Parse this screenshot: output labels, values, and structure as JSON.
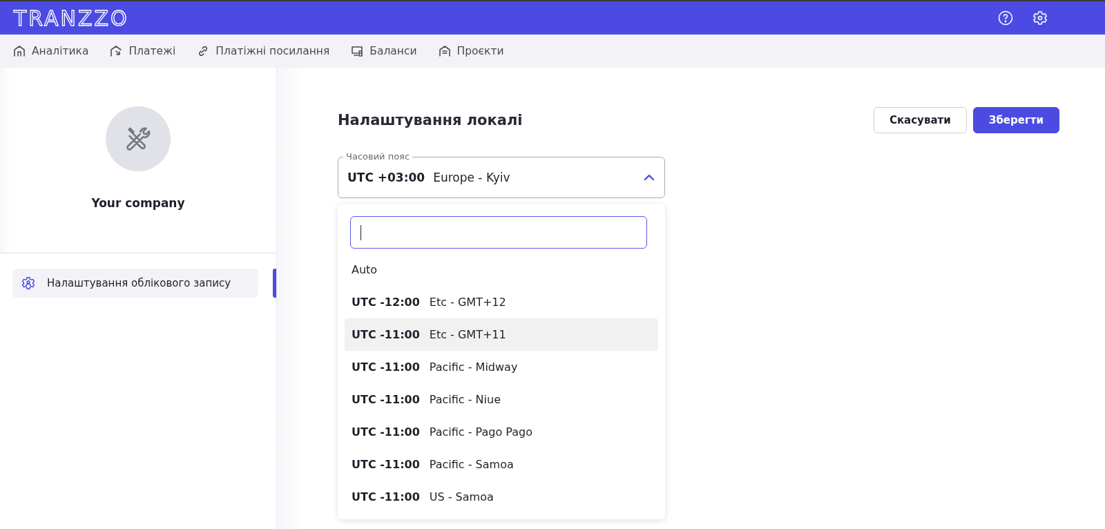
{
  "header": {
    "logo": "TRANZZO"
  },
  "nav": [
    {
      "label": "Аналітика"
    },
    {
      "label": "Платежі"
    },
    {
      "label": "Платіжні посилання"
    },
    {
      "label": "Баланси"
    },
    {
      "label": "Проєкти"
    }
  ],
  "sidebar": {
    "company": "Your company",
    "items": [
      {
        "label": "Налаштування облікового запису",
        "selected": true
      }
    ]
  },
  "panel": {
    "title": "Налаштування локалі",
    "buttons": [
      {
        "label": "Скасувати",
        "kind": "secondary"
      },
      {
        "label": "Зберегти",
        "kind": "primary"
      }
    ],
    "timezone": {
      "label": "Часовий пояс",
      "offset": "UTC +03:00",
      "zone": "Europe - Kyiv",
      "expanded": true
    },
    "options": [
      {
        "kind": "auto",
        "label": "Auto",
        "highlighted": false
      },
      {
        "kind": "zone",
        "offset": "UTC -12:00",
        "zone": "Etc - GMT+12",
        "highlighted": false
      },
      {
        "kind": "zone",
        "offset": "UTC -11:00",
        "zone": "Etc - GMT+11",
        "highlighted": true
      },
      {
        "kind": "zone",
        "offset": "UTC -11:00",
        "zone": "Pacific - Midway",
        "highlighted": false
      },
      {
        "kind": "zone",
        "offset": "UTC -11:00",
        "zone": "Pacific - Niue",
        "highlighted": false
      },
      {
        "kind": "zone",
        "offset": "UTC -11:00",
        "zone": "Pacific - Pago Pago",
        "highlighted": false
      },
      {
        "kind": "zone",
        "offset": "UTC -11:00",
        "zone": "Pacific - Samoa",
        "highlighted": false
      },
      {
        "kind": "zone",
        "offset": "UTC -11:00",
        "zone": "US - Samoa",
        "highlighted": false
      }
    ]
  }
}
